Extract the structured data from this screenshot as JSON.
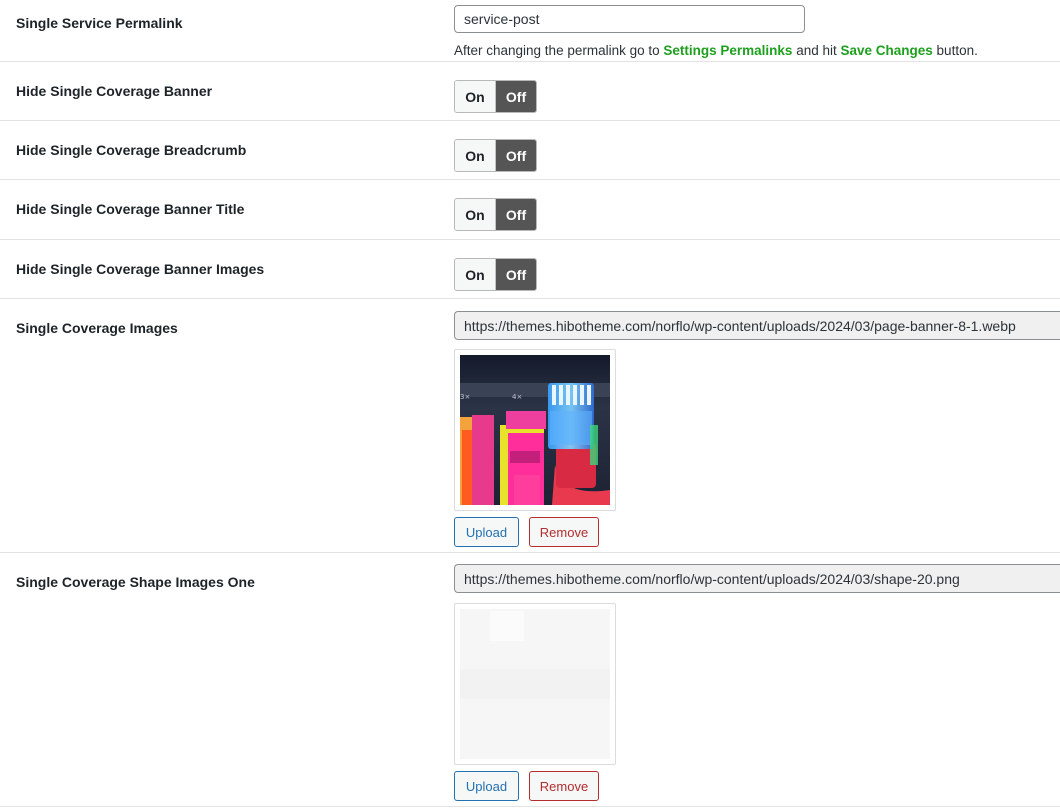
{
  "permalink": {
    "label": "Single Service Permalink",
    "value": "service-post",
    "desc_before": "After changing the permalink go to ",
    "settings_link": "Settings Permalinks",
    "desc_middle": " and hit ",
    "save_link": "Save Changes",
    "desc_after": " button."
  },
  "toggles": [
    {
      "label": "Hide Single Coverage Banner",
      "on": "On",
      "off": "Off",
      "selected": "Off"
    },
    {
      "label": "Hide Single Coverage Breadcrumb",
      "on": "On",
      "off": "Off",
      "selected": "Off"
    },
    {
      "label": "Hide Single Coverage Banner Title",
      "on": "On",
      "off": "Off",
      "selected": "Off"
    },
    {
      "label": "Hide Single Coverage Banner Images",
      "on": "On",
      "off": "Off",
      "selected": "Off"
    }
  ],
  "images": {
    "label": "Single Coverage Images",
    "url": "https://themes.hibotheme.com/norflo/wp-content/uploads/2024/03/page-banner-8-1.webp",
    "upload": "Upload",
    "remove": "Remove"
  },
  "shape_one": {
    "label": "Single Coverage Shape Images One",
    "url": "https://themes.hibotheme.com/norflo/wp-content/uploads/2024/03/shape-20.png",
    "upload": "Upload",
    "remove": "Remove"
  },
  "colors": {
    "link_green": "#1ea01e",
    "upload_blue": "#2271b1",
    "remove_red": "#b32d2e",
    "toggle_off_bg": "#555555"
  }
}
